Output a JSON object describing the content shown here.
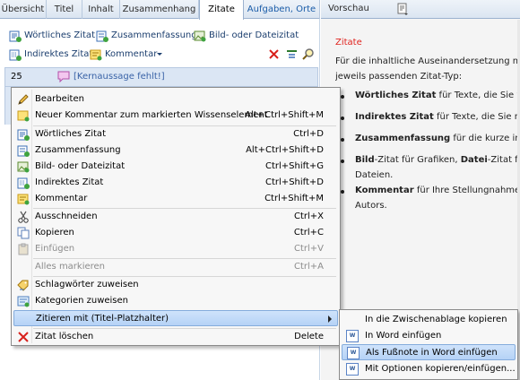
{
  "tabs": [
    "Übersicht",
    "Titel",
    "Inhalt",
    "Zusammenhang",
    "Zitate",
    "Aufgaben, Orte"
  ],
  "active_tab": "Zitate",
  "toolbar": {
    "woertlich": "Wörtliches Zitat",
    "zusammenfassung": "Zusammenfassung",
    "bild": "Bild- oder Dateizitat",
    "indirekt": "Indirektes Zitat",
    "kommentar": "Kommentar"
  },
  "row": {
    "number": "25",
    "message": "[Kernaussage fehlt!]"
  },
  "menu": [
    {
      "label": "Bearbeiten",
      "shortcut": "",
      "icon": "pencil-icon"
    },
    {
      "label": "Neuer Kommentar zum markierten Wissenselement",
      "shortcut": "Alt+Ctrl+Shift+M",
      "icon": "new-comment-icon"
    },
    {
      "label": "Wörtliches Zitat",
      "shortcut": "Ctrl+D",
      "icon": "quote-icon"
    },
    {
      "label": "Zusammenfassung",
      "shortcut": "Alt+Ctrl+Shift+D",
      "icon": "summary-icon"
    },
    {
      "label": "Bild- oder Dateizitat",
      "shortcut": "Ctrl+Shift+G",
      "icon": "image-icon"
    },
    {
      "label": "Indirektes Zitat",
      "shortcut": "Ctrl+Shift+D",
      "icon": "indirect-quote-icon"
    },
    {
      "label": "Kommentar",
      "shortcut": "Ctrl+Shift+M",
      "icon": "comment-icon"
    },
    {
      "label": "Ausschneiden",
      "shortcut": "Ctrl+X",
      "icon": "scissors-icon"
    },
    {
      "label": "Kopieren",
      "shortcut": "Ctrl+C",
      "icon": "copy-icon"
    },
    {
      "label": "Einfügen",
      "shortcut": "Ctrl+V",
      "icon": "paste-icon"
    },
    {
      "label": "Alles markieren",
      "shortcut": "Ctrl+A",
      "icon": ""
    },
    {
      "label": "Schlagwörter zuweisen",
      "shortcut": "",
      "icon": "keywords-icon"
    },
    {
      "label": "Kategorien zuweisen",
      "shortcut": "",
      "icon": "categories-icon"
    },
    {
      "label": "Zitieren mit  (Titel-Platzhalter)",
      "shortcut": "",
      "icon": ""
    },
    {
      "label": "Zitat löschen",
      "shortcut": "Delete",
      "icon": "delete-icon"
    }
  ],
  "submenu": [
    "In die Zwischenablage kopieren",
    "In Word einfügen",
    "Als Fußnote in Word einfügen",
    "Mit Optionen kopieren/einfügen..."
  ],
  "preview": {
    "tab": "Vorschau",
    "heading": "Zitate",
    "intro1": "Für die inhaltliche Auseinandersetzung mit der",
    "intro2": "jeweils passenden Zitat-Typ:",
    "b1_bold": "Wörtliches Zitat",
    "b1_rest": " für Texte, die Sie wort- u",
    "b2_bold": "Indirektes Zitat",
    "b2_rest": " für Texte, die Sie mit eige",
    "b3_bold": "Zusammenfassung",
    "b3_rest": " für die kurze inhaltlic",
    "b4_bold1": "Bild",
    "b4_mid": "-Zitat für Grafiken, ",
    "b4_bold2": "Datei",
    "b4_rest": "-Zitat für Be",
    "b4_line2": "Dateien.",
    "b5_bold": "Kommentar",
    "b5_rest": " für Ihre Stellungnahmen zu e",
    "b5_line2": "Autors."
  }
}
